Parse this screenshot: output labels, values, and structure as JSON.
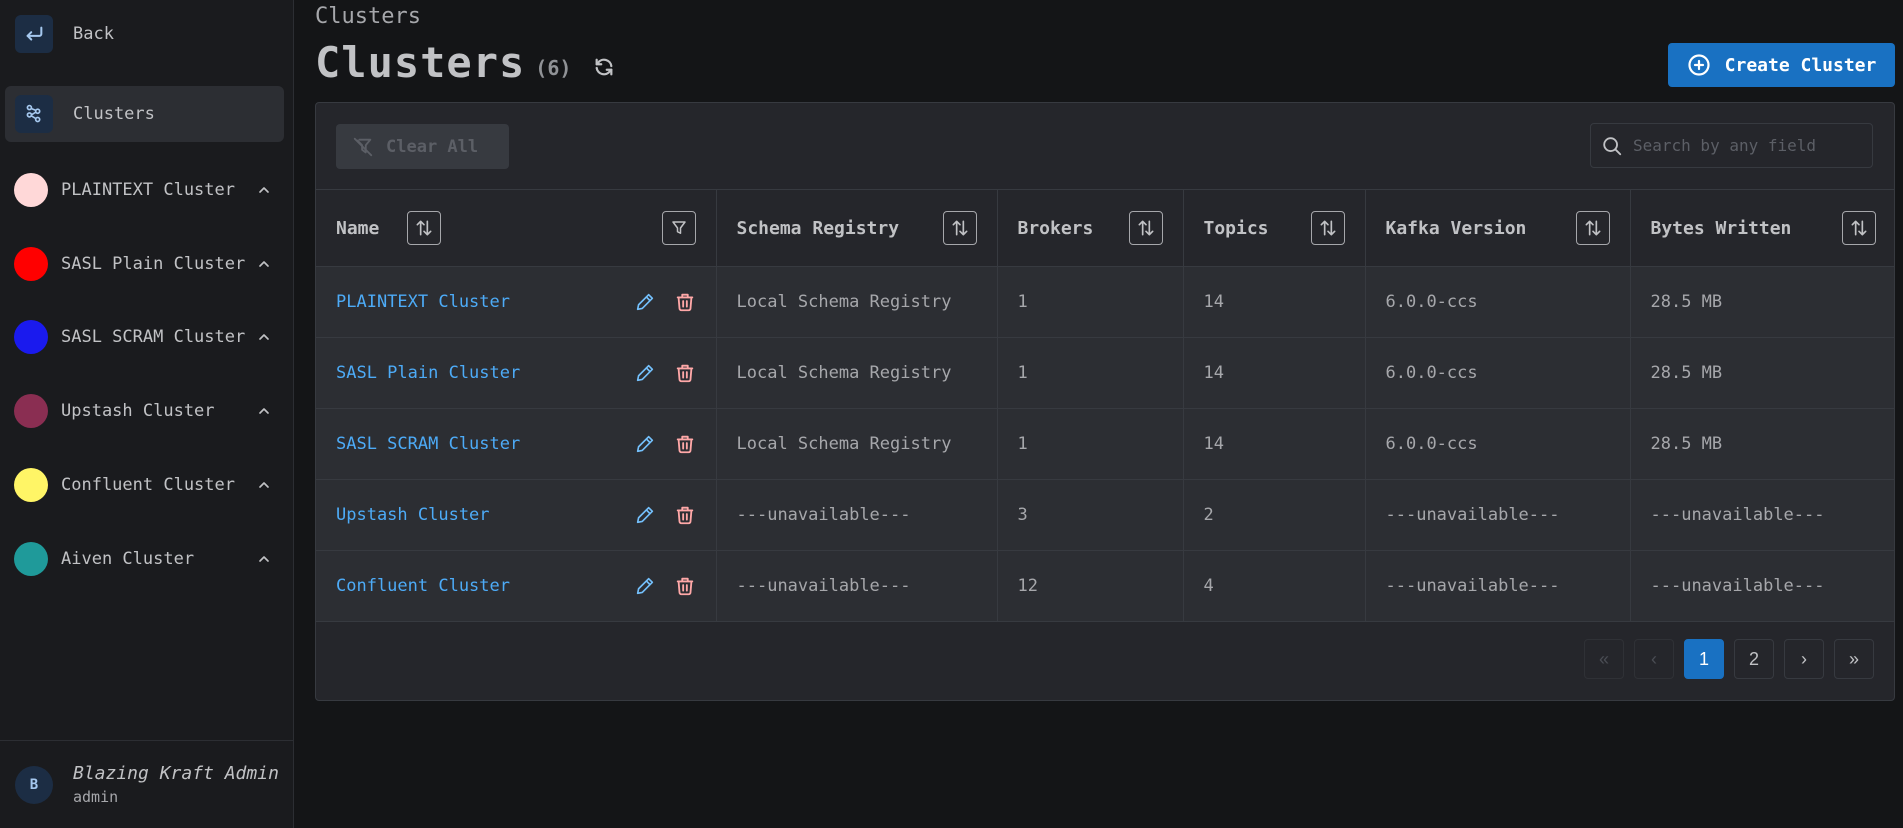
{
  "sidebar": {
    "back_label": "Back",
    "clusters_label": "Clusters",
    "clusters": [
      {
        "label": "PLAINTEXT Cluster",
        "color": "#ffd8d8"
      },
      {
        "label": "SASL Plain Cluster",
        "color": "#ff0000"
      },
      {
        "label": "SASL SCRAM Cluster",
        "color": "#1a1aee"
      },
      {
        "label": "Upstash Cluster",
        "color": "#8a2e52"
      },
      {
        "label": "Confluent Cluster",
        "color": "#fff566"
      },
      {
        "label": "Aiven Cluster",
        "color": "#1f9a9a"
      }
    ],
    "user": {
      "initial": "B",
      "name": "Blazing Kraft Admin",
      "role": "admin"
    }
  },
  "header": {
    "breadcrumb": "Clusters",
    "title": "Clusters",
    "count": "(6)",
    "create_label": "Create Cluster"
  },
  "toolbar": {
    "clear_label": "Clear All",
    "search_placeholder": "Search by any field"
  },
  "table": {
    "columns": [
      "Name",
      "Schema Registry",
      "Brokers",
      "Topics",
      "Kafka Version",
      "Bytes Written"
    ],
    "rows": [
      [
        "PLAINTEXT Cluster",
        "Local Schema Registry",
        "1",
        "14",
        "6.0.0-ccs",
        "28.5 MB"
      ],
      [
        "SASL Plain Cluster",
        "Local Schema Registry",
        "1",
        "14",
        "6.0.0-ccs",
        "28.5 MB"
      ],
      [
        "SASL SCRAM Cluster",
        "Local Schema Registry",
        "1",
        "14",
        "6.0.0-ccs",
        "28.5 MB"
      ],
      [
        "Upstash Cluster",
        "---unavailable---",
        "3",
        "2",
        "---unavailable---",
        "---unavailable---"
      ],
      [
        "Confluent Cluster",
        "---unavailable---",
        "12",
        "4",
        "---unavailable---",
        "---unavailable---"
      ]
    ]
  },
  "pagination": {
    "first": "«",
    "prev": "‹",
    "pages": [
      "1",
      "2"
    ],
    "current": "1",
    "next": "›",
    "last": "»"
  },
  "colors": {
    "accent": "#1971c2",
    "link": "#4dabf7",
    "danger": "#ffa8a8"
  }
}
